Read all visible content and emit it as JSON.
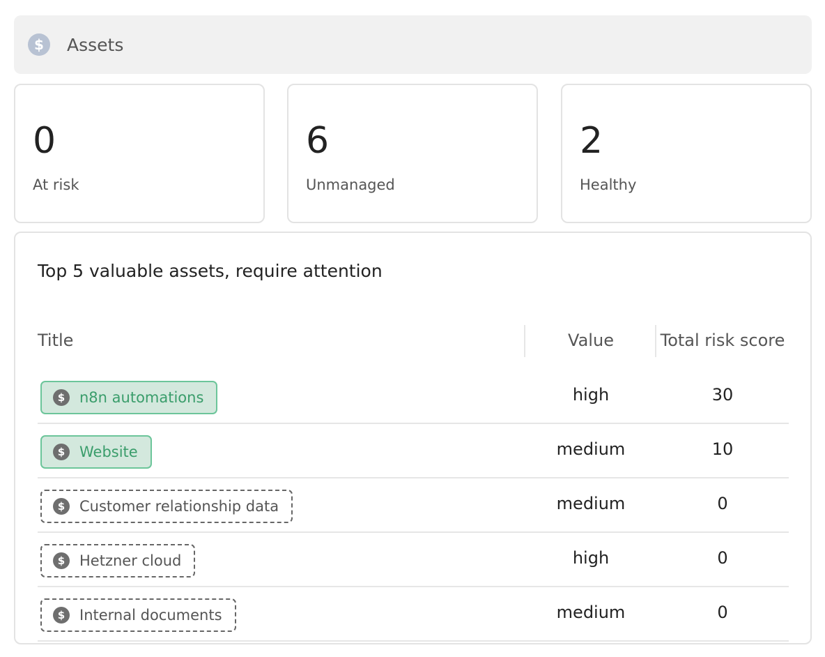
{
  "header": {
    "title": "Assets",
    "icon": "dollar-icon"
  },
  "stats": [
    {
      "value": "0",
      "label": "At risk"
    },
    {
      "value": "6",
      "label": "Unmanaged"
    },
    {
      "value": "2",
      "label": "Healthy"
    }
  ],
  "table": {
    "title": "Top 5 valuable assets, require attention",
    "columns": {
      "title": "Title",
      "value": "Value",
      "risk": "Total risk score"
    },
    "rows": [
      {
        "title": "n8n automations",
        "value": "high",
        "risk": "30",
        "status": "managed"
      },
      {
        "title": "Website",
        "value": "medium",
        "risk": "10",
        "status": "managed"
      },
      {
        "title": "Customer relationship data",
        "value": "medium",
        "risk": "0",
        "status": "unmanaged"
      },
      {
        "title": "Hetzner cloud",
        "value": "high",
        "risk": "0",
        "status": "unmanaged"
      },
      {
        "title": "Internal documents",
        "value": "medium",
        "risk": "0",
        "status": "unmanaged"
      }
    ]
  },
  "colors": {
    "managed_bg": "#d3e8dd",
    "managed_border": "#6cc59a",
    "managed_text": "#3a9d6b"
  }
}
